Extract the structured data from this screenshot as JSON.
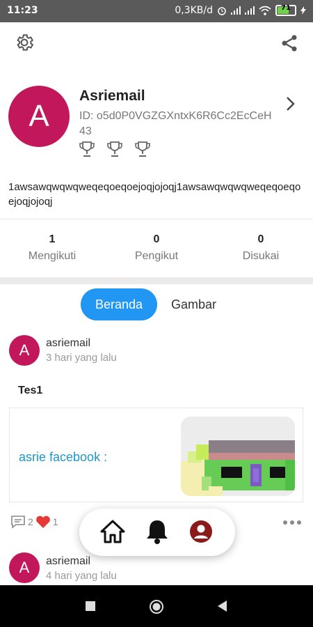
{
  "status_bar": {
    "time": "11:23",
    "network_speed": "0,3KB/d",
    "battery_level": "71"
  },
  "profile": {
    "avatar_letter": "A",
    "username": "Asriemail",
    "id_text": "ID: o5d0P0VGZGXntxK6R6Cc2EcCeH43",
    "bio": "1awsawqwqwqweqeqoeqoejoqjojoqj1awsawqwqwqweqeqoeqoejoqjojoqj"
  },
  "stats": [
    {
      "value": "1",
      "label": "Mengikuti"
    },
    {
      "value": "0",
      "label": "Pengikut"
    },
    {
      "value": "0",
      "label": "Disukai"
    }
  ],
  "tabs": {
    "active": "Beranda",
    "other": "Gambar"
  },
  "posts": [
    {
      "avatar_letter": "A",
      "author": "asriemail",
      "time": "3 hari yang lalu",
      "title": "Tes1",
      "card_text": "asrie facebook :",
      "comments": "2",
      "likes": "1"
    },
    {
      "avatar_letter": "A",
      "author": "asriemail",
      "time": "4 hari yang lalu"
    }
  ],
  "colors": {
    "avatar": "#c2185b",
    "accent": "#2196f3",
    "link": "#2196c8",
    "like": "#e53935",
    "profile_icon": "#8b1a1a"
  },
  "icons": [
    "gear-icon",
    "share-icon",
    "chevron-right-icon",
    "trophy-icon",
    "comment-icon",
    "heart-icon",
    "more-icon",
    "home-icon",
    "bell-icon",
    "user-icon"
  ]
}
